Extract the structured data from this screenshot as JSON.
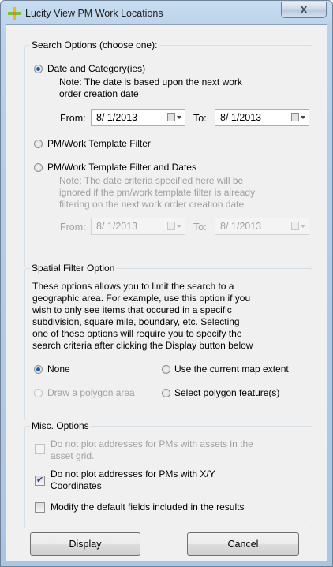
{
  "window": {
    "title": "Lucity View PM Work Locations",
    "close_label": "X"
  },
  "search_options": {
    "legend": "Search Options (choose one):",
    "date_category": {
      "label": "Date and Category(ies)",
      "note_line1": "Note:  The date is based upon the next work",
      "note_line2": "order creation date",
      "from_label": "From:",
      "from_value": "8/  1/2013",
      "to_label": "To:",
      "to_value": "8/  1/2013",
      "selected": true
    },
    "template_filter": {
      "label": "PM/Work Template Filter",
      "selected": false
    },
    "template_filter_dates": {
      "label": "PM/Work Template Filter and Dates",
      "note_line1": "Note:  The date criteria specified here will be",
      "note_line2": "ignored if the pm/work template filter is already",
      "note_line3": "filtering on the next work order creation date",
      "from_label": "From:",
      "from_value": "8/  1/2013",
      "to_label": "To:",
      "to_value": "8/  1/2013",
      "selected": false
    }
  },
  "spatial": {
    "legend": "Spatial Filter Option",
    "desc_lines": [
      "These options allows you to limit the search to a",
      "geographic area.  For example, use this option if you",
      "wish to only see items that occured in a specific",
      "subdivision, square mile, boundary, etc.  Selecting",
      "one of these options will require you to specify the",
      "search criteria after clicking the Display button below"
    ],
    "none_label": "None",
    "map_extent_label": "Use the current map extent",
    "polygon_area_label": "Draw a polygon area",
    "polygon_feature_label": "Select polygon feature(s)",
    "selected": "None"
  },
  "misc": {
    "legend": "Misc. Options",
    "opt1_line1": "Do not plot addresses for PMs with assets in the",
    "opt1_line2": "asset grid.",
    "opt1_checked": false,
    "opt2_line1": "Do not plot addresses for PMs with X/Y",
    "opt2_line2": "Coordinates",
    "opt2_checked": true,
    "opt3_label": "Modify the default fields included in the results",
    "opt3_checked": false
  },
  "buttons": {
    "display": "Display",
    "cancel": "Cancel"
  },
  "icons": {
    "app": "lucity-cross-icon",
    "close": "close-icon",
    "calendar": "calendar-icon"
  }
}
